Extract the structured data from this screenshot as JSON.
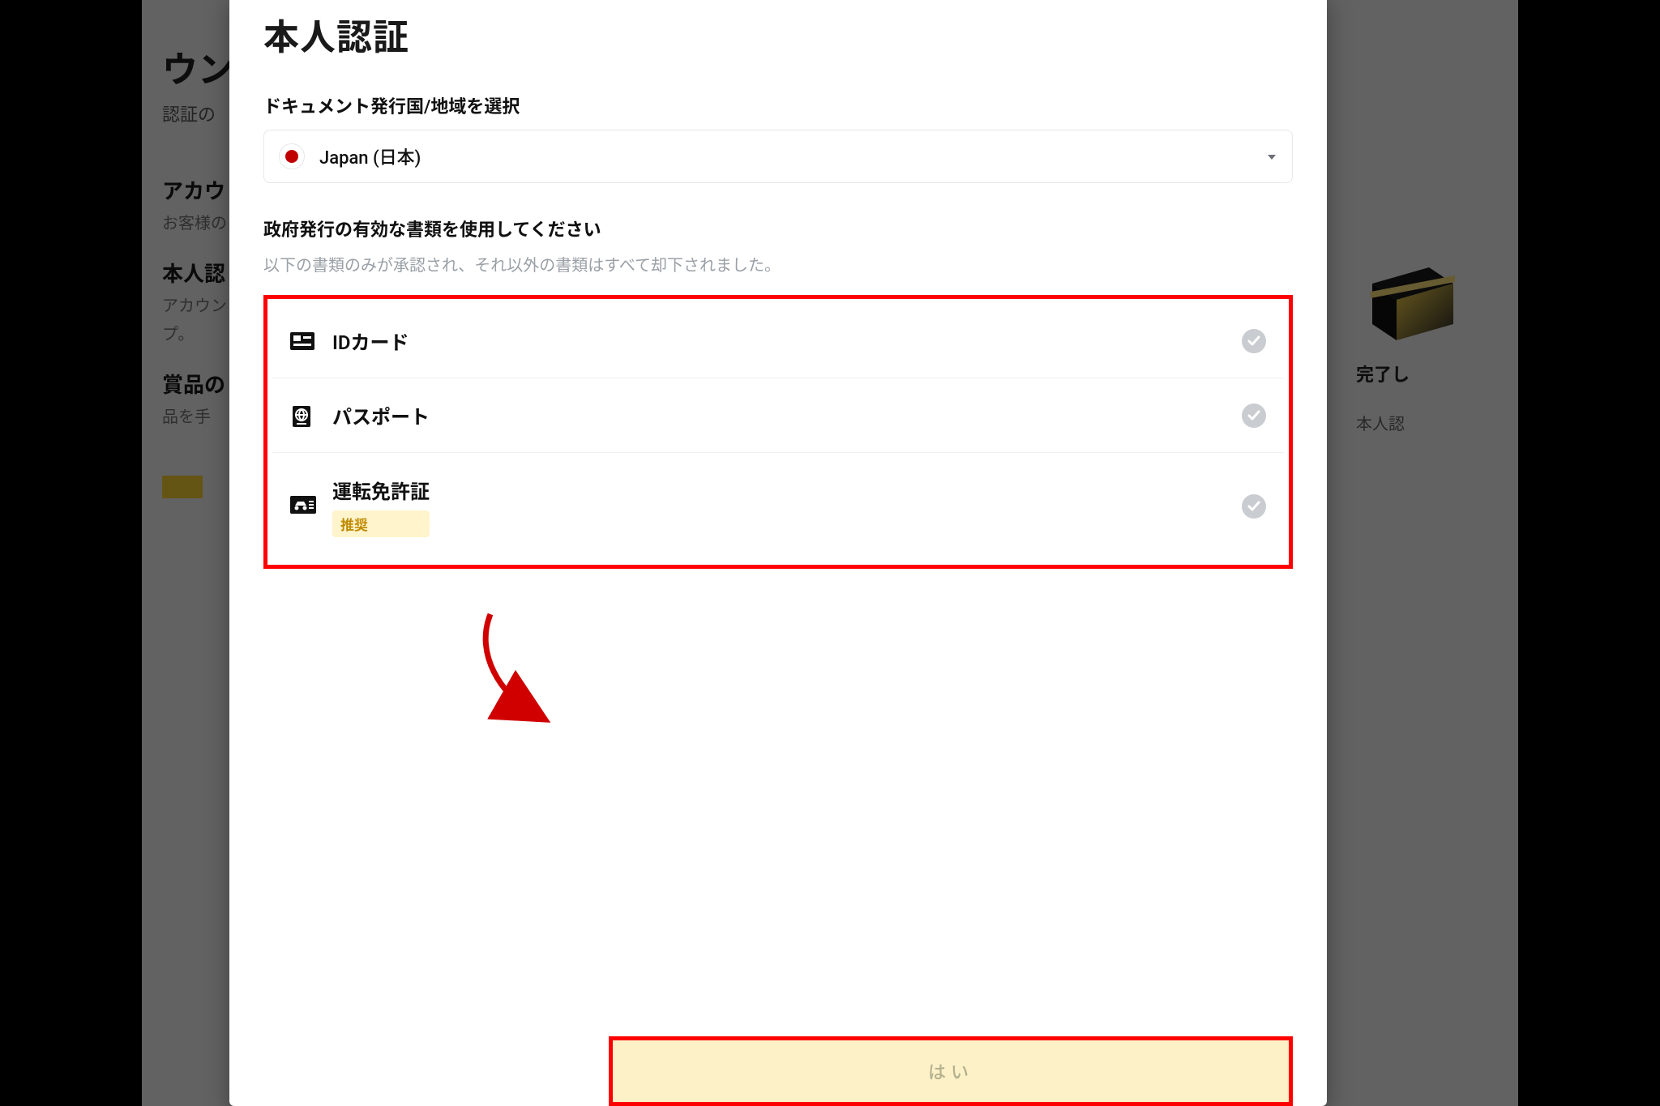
{
  "background": {
    "title_fragment": "ウン",
    "subtitle_fragment": "認証の",
    "item1_title_fragment": "アカウ",
    "item1_sub_fragment": "お客様の",
    "item2_title_fragment": "本人認",
    "item2_sub1_fragment": "アカウント",
    "item2_sub2_fragment": "プ。",
    "item3_title_fragment": "賞品の",
    "item3_sub_fragment": "品を手",
    "right_line1": "完了し",
    "right_line2": "本人認"
  },
  "modal": {
    "title": "本人認証",
    "section_country_label": "ドキュメント発行国/地域を選択",
    "country": {
      "name": "Japan (日本)",
      "flag_color": "#c00000"
    },
    "section_doc_label": "政府発行の有効な書類を使用してください",
    "helper": "以下の書類のみが承認され、それ以外の書類はすべて却下されました。",
    "docs": [
      {
        "label": "IDカード",
        "badge": ""
      },
      {
        "label": "パスポート",
        "badge": ""
      },
      {
        "label": "運転免許証",
        "badge": "推奨"
      }
    ],
    "confirm_label": "はい"
  },
  "colors": {
    "annotation_red": "#ff0000",
    "brand_yellow": "#fcd535",
    "soft_yellow": "#fdf1c7",
    "badge_bg": "#fff4cc",
    "badge_fg": "#c08a00",
    "check_bg": "#c9ccd0"
  }
}
